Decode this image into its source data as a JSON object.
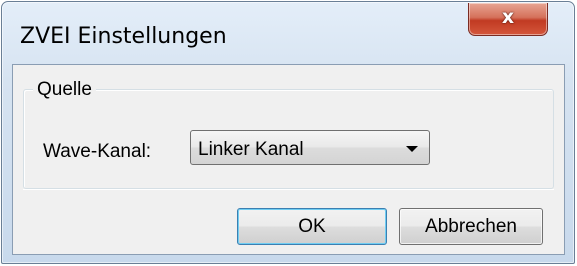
{
  "window": {
    "title": "ZVEI Einstellungen",
    "close_icon": "close-icon",
    "close_glyph": "x"
  },
  "group": {
    "legend": "Quelle",
    "wave_label": "Wave-Kanal:",
    "select_value": "Linker Kanal"
  },
  "buttons": {
    "ok": "OK",
    "cancel": "Abbrechen"
  },
  "colors": {
    "close_button": "#c13a22",
    "client_background": "#f0f0f0",
    "frame": "#c8d9ec"
  }
}
